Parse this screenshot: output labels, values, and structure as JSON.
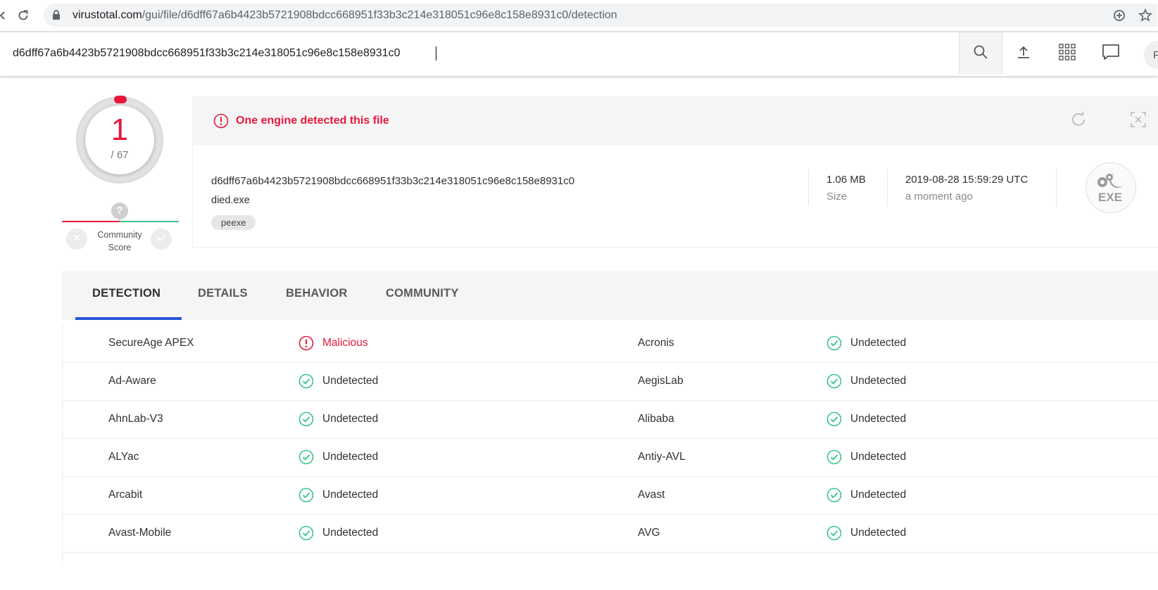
{
  "browser": {
    "url_host": "virustotal.com",
    "url_path": "/gui/file/d6dff67a6b4423b5721908bdcc668951f33b3c214e318051c96e8c158e8931c0/detection"
  },
  "search": {
    "value": "d6dff67a6b4423b5721908bdcc668951f33b3c214e318051c96e8c158e8931c0"
  },
  "header": {
    "avatar_initial": "F"
  },
  "score": {
    "detections": "1",
    "total": "/ 67",
    "detection_fraction": 0.0149
  },
  "community": {
    "question": "?",
    "label_line1": "Community",
    "label_line2": "Score"
  },
  "alert": {
    "text": "One engine detected this file"
  },
  "file": {
    "hash": "d6dff67a6b4423b5721908bdcc668951f33b3c214e318051c96e8c158e8931c0",
    "name": "died.exe",
    "tag": "peexe",
    "size_value": "1.06 MB",
    "size_label": "Size",
    "date_value": "2019-08-28 15:59:29 UTC",
    "date_relative": "a moment ago",
    "type_icon_text": "EXE"
  },
  "tabs": [
    {
      "label": "DETECTION",
      "active": true
    },
    {
      "label": "DETAILS"
    },
    {
      "label": "BEHAVIOR"
    },
    {
      "label": "COMMUNITY"
    }
  ],
  "colors": {
    "malicious": "#e8183c",
    "undetected": "#3ac48a",
    "tab_accent": "#2b54d8"
  },
  "detections": [
    {
      "engine_left": "SecureAge APEX",
      "result_left": "Malicious",
      "status_left": "malicious",
      "engine_right": "Acronis",
      "result_right": "Undetected",
      "status_right": "undetected"
    },
    {
      "engine_left": "Ad-Aware",
      "result_left": "Undetected",
      "status_left": "undetected",
      "engine_right": "AegisLab",
      "result_right": "Undetected",
      "status_right": "undetected"
    },
    {
      "engine_left": "AhnLab-V3",
      "result_left": "Undetected",
      "status_left": "undetected",
      "engine_right": "Alibaba",
      "result_right": "Undetected",
      "status_right": "undetected"
    },
    {
      "engine_left": "ALYac",
      "result_left": "Undetected",
      "status_left": "undetected",
      "engine_right": "Antiy-AVL",
      "result_right": "Undetected",
      "status_right": "undetected"
    },
    {
      "engine_left": "Arcabit",
      "result_left": "Undetected",
      "status_left": "undetected",
      "engine_right": "Avast",
      "result_right": "Undetected",
      "status_right": "undetected"
    },
    {
      "engine_left": "Avast-Mobile",
      "result_left": "Undetected",
      "status_left": "undetected",
      "engine_right": "AVG",
      "result_right": "Undetected",
      "status_right": "undetected"
    }
  ]
}
